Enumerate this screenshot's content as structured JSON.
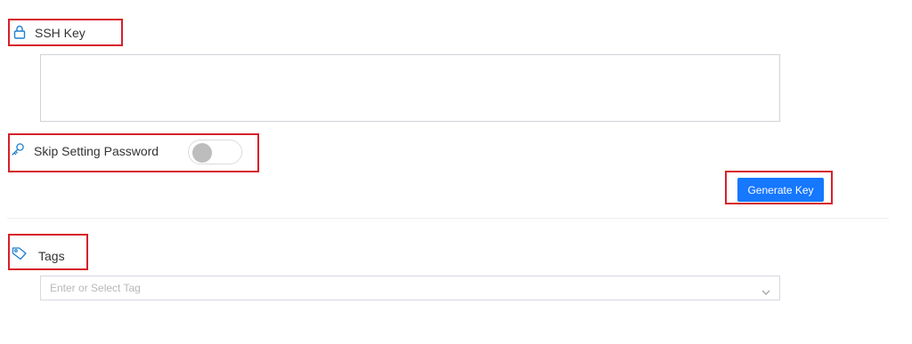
{
  "ssh_key": {
    "label": "SSH Key",
    "icon": "lock-icon",
    "value": ""
  },
  "skip_password": {
    "label": "Skip Setting Password",
    "icon": "key-icon",
    "enabled": false
  },
  "generate_key": {
    "label": "Generate Key",
    "color": "#1677ff"
  },
  "tags": {
    "label": "Tags",
    "icon": "tag-icon",
    "placeholder": "Enter or Select Tag",
    "dropdown_icon": "chevron-down-icon"
  },
  "colors": {
    "highlight": "#d6202b",
    "icon": "#1f7fd0"
  }
}
